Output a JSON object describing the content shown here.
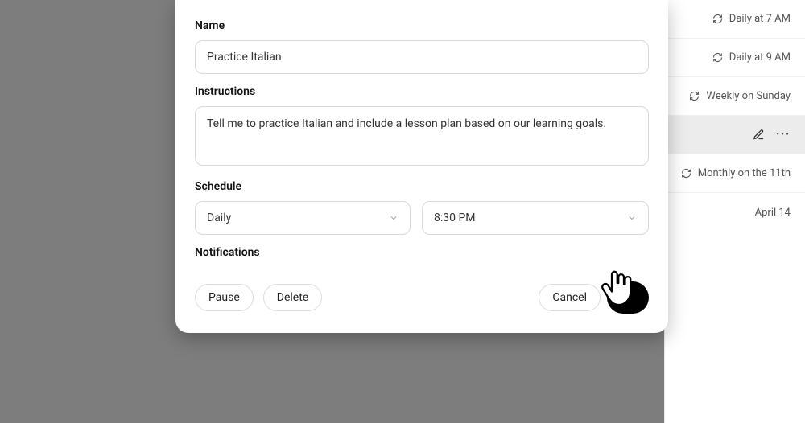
{
  "side_list": {
    "items": [
      {
        "label": "Daily at 7 AM"
      },
      {
        "label": "Daily at 9 AM"
      },
      {
        "label": "Weekly on Sunday"
      },
      {
        "label": ""
      },
      {
        "label": "Monthly on the 11th"
      },
      {
        "label": "April 14"
      }
    ]
  },
  "dialog": {
    "name_label": "Name",
    "name_value": "Practice Italian",
    "instructions_label": "Instructions",
    "instructions_value": "Tell me to practice Italian and include a lesson plan based on our learning goals.",
    "schedule_label": "Schedule",
    "frequency_value": "Daily",
    "time_value": "8:30 PM",
    "notifications_label": "Notifications",
    "pause_label": "Pause",
    "delete_label": "Delete",
    "cancel_label": "Cancel"
  }
}
